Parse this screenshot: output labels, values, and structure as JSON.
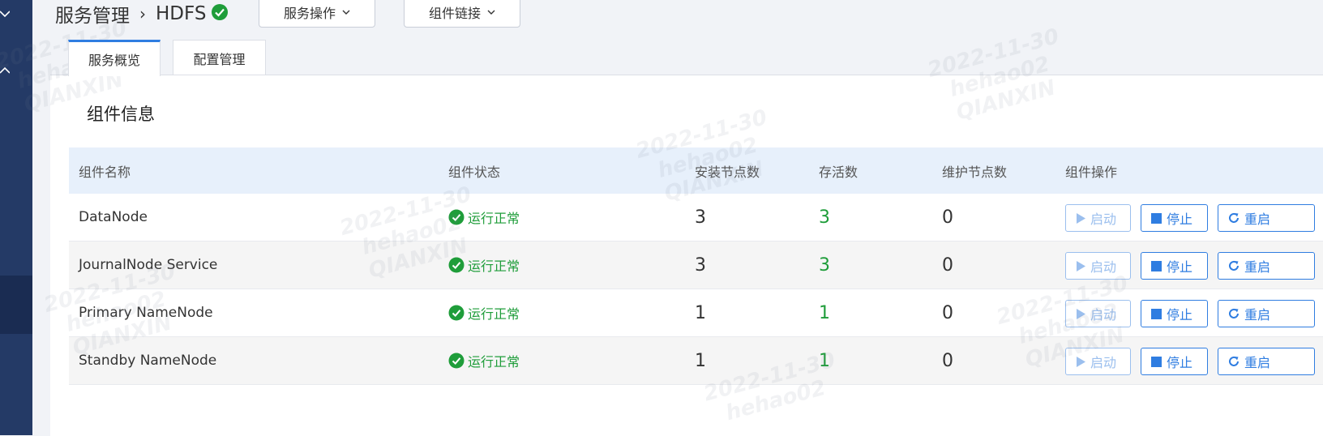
{
  "breadcrumb": {
    "parent": "服务管理",
    "separator": "›",
    "current": "HDFS"
  },
  "header_buttons": {
    "service_ops": "服务操作",
    "component_links": "组件链接"
  },
  "tabs": [
    {
      "label": "服务概览",
      "active": true
    },
    {
      "label": "配置管理",
      "active": false
    }
  ],
  "section": {
    "title": "组件信息"
  },
  "table": {
    "headers": [
      "组件名称",
      "组件状态",
      "安装节点数",
      "存活数",
      "维护节点数",
      "组件操作"
    ],
    "rows": [
      {
        "name": "DataNode",
        "status": "运行正常",
        "installed": "3",
        "alive": "3",
        "maintenance": "0"
      },
      {
        "name": "JournalNode Service",
        "status": "运行正常",
        "installed": "3",
        "alive": "3",
        "maintenance": "0"
      },
      {
        "name": "Primary NameNode",
        "status": "运行正常",
        "installed": "1",
        "alive": "1",
        "maintenance": "0"
      },
      {
        "name": "Standby NameNode",
        "status": "运行正常",
        "installed": "1",
        "alive": "1",
        "maintenance": "0"
      }
    ],
    "actions": {
      "start": "启动",
      "stop": "停止",
      "restart": "重启"
    }
  },
  "watermark": {
    "date": "2022-11-30",
    "user": "hehao02",
    "org": "QIANXIN"
  },
  "colors": {
    "sidebar": "#243a66",
    "accent": "#2f7de1",
    "success": "#1f9d3a",
    "header_row": "#e7f0fb"
  }
}
